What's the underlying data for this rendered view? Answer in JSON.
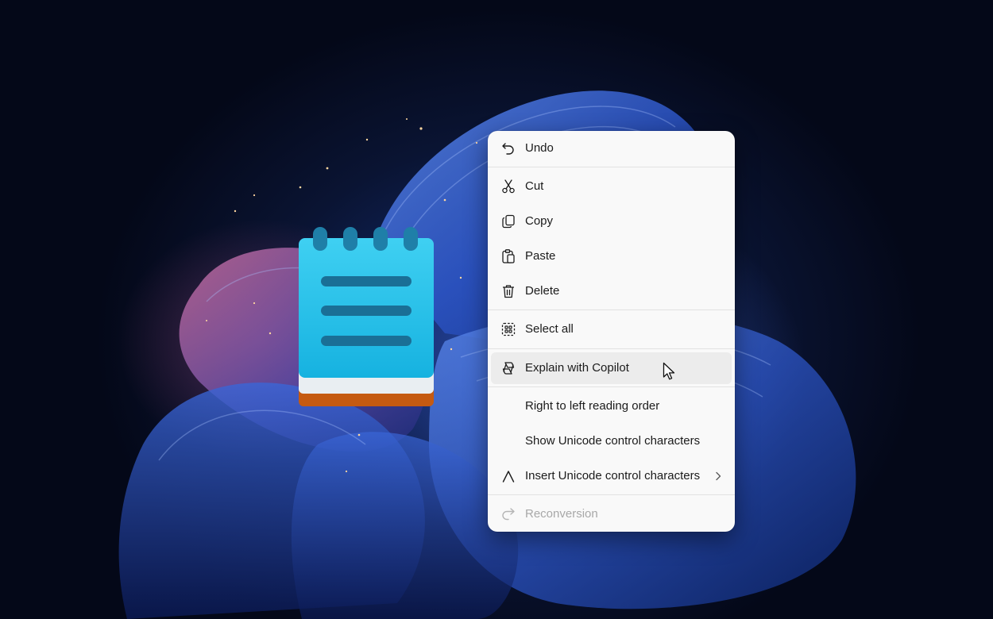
{
  "context_menu": {
    "items": [
      {
        "label": "Undo",
        "icon": "undo-icon"
      },
      {
        "label": "Cut",
        "icon": "scissors-icon"
      },
      {
        "label": "Copy",
        "icon": "copy-icon"
      },
      {
        "label": "Paste",
        "icon": "paste-icon"
      },
      {
        "label": "Delete",
        "icon": "trash-icon"
      },
      {
        "label": "Select all",
        "icon": "select-all-icon"
      },
      {
        "label": "Explain with Copilot",
        "icon": "copilot-icon",
        "state": "hovered"
      },
      {
        "label": "Right to left reading order",
        "icon": ""
      },
      {
        "label": "Show Unicode control characters",
        "icon": ""
      },
      {
        "label": "Insert Unicode control characters",
        "icon": "caret-icon",
        "has_submenu": true
      },
      {
        "label": "Reconversion",
        "icon": "reconversion-icon",
        "state": "disabled"
      }
    ]
  },
  "app_icon": "notepad-icon",
  "colors": {
    "menu_background": "#f9f9f9",
    "hover_background": "#ececec",
    "text": "#1b1b1b",
    "disabled_text": "#a8a8a8",
    "notepad_cyan": "#29c3ea",
    "notepad_orange": "#c55a11"
  }
}
